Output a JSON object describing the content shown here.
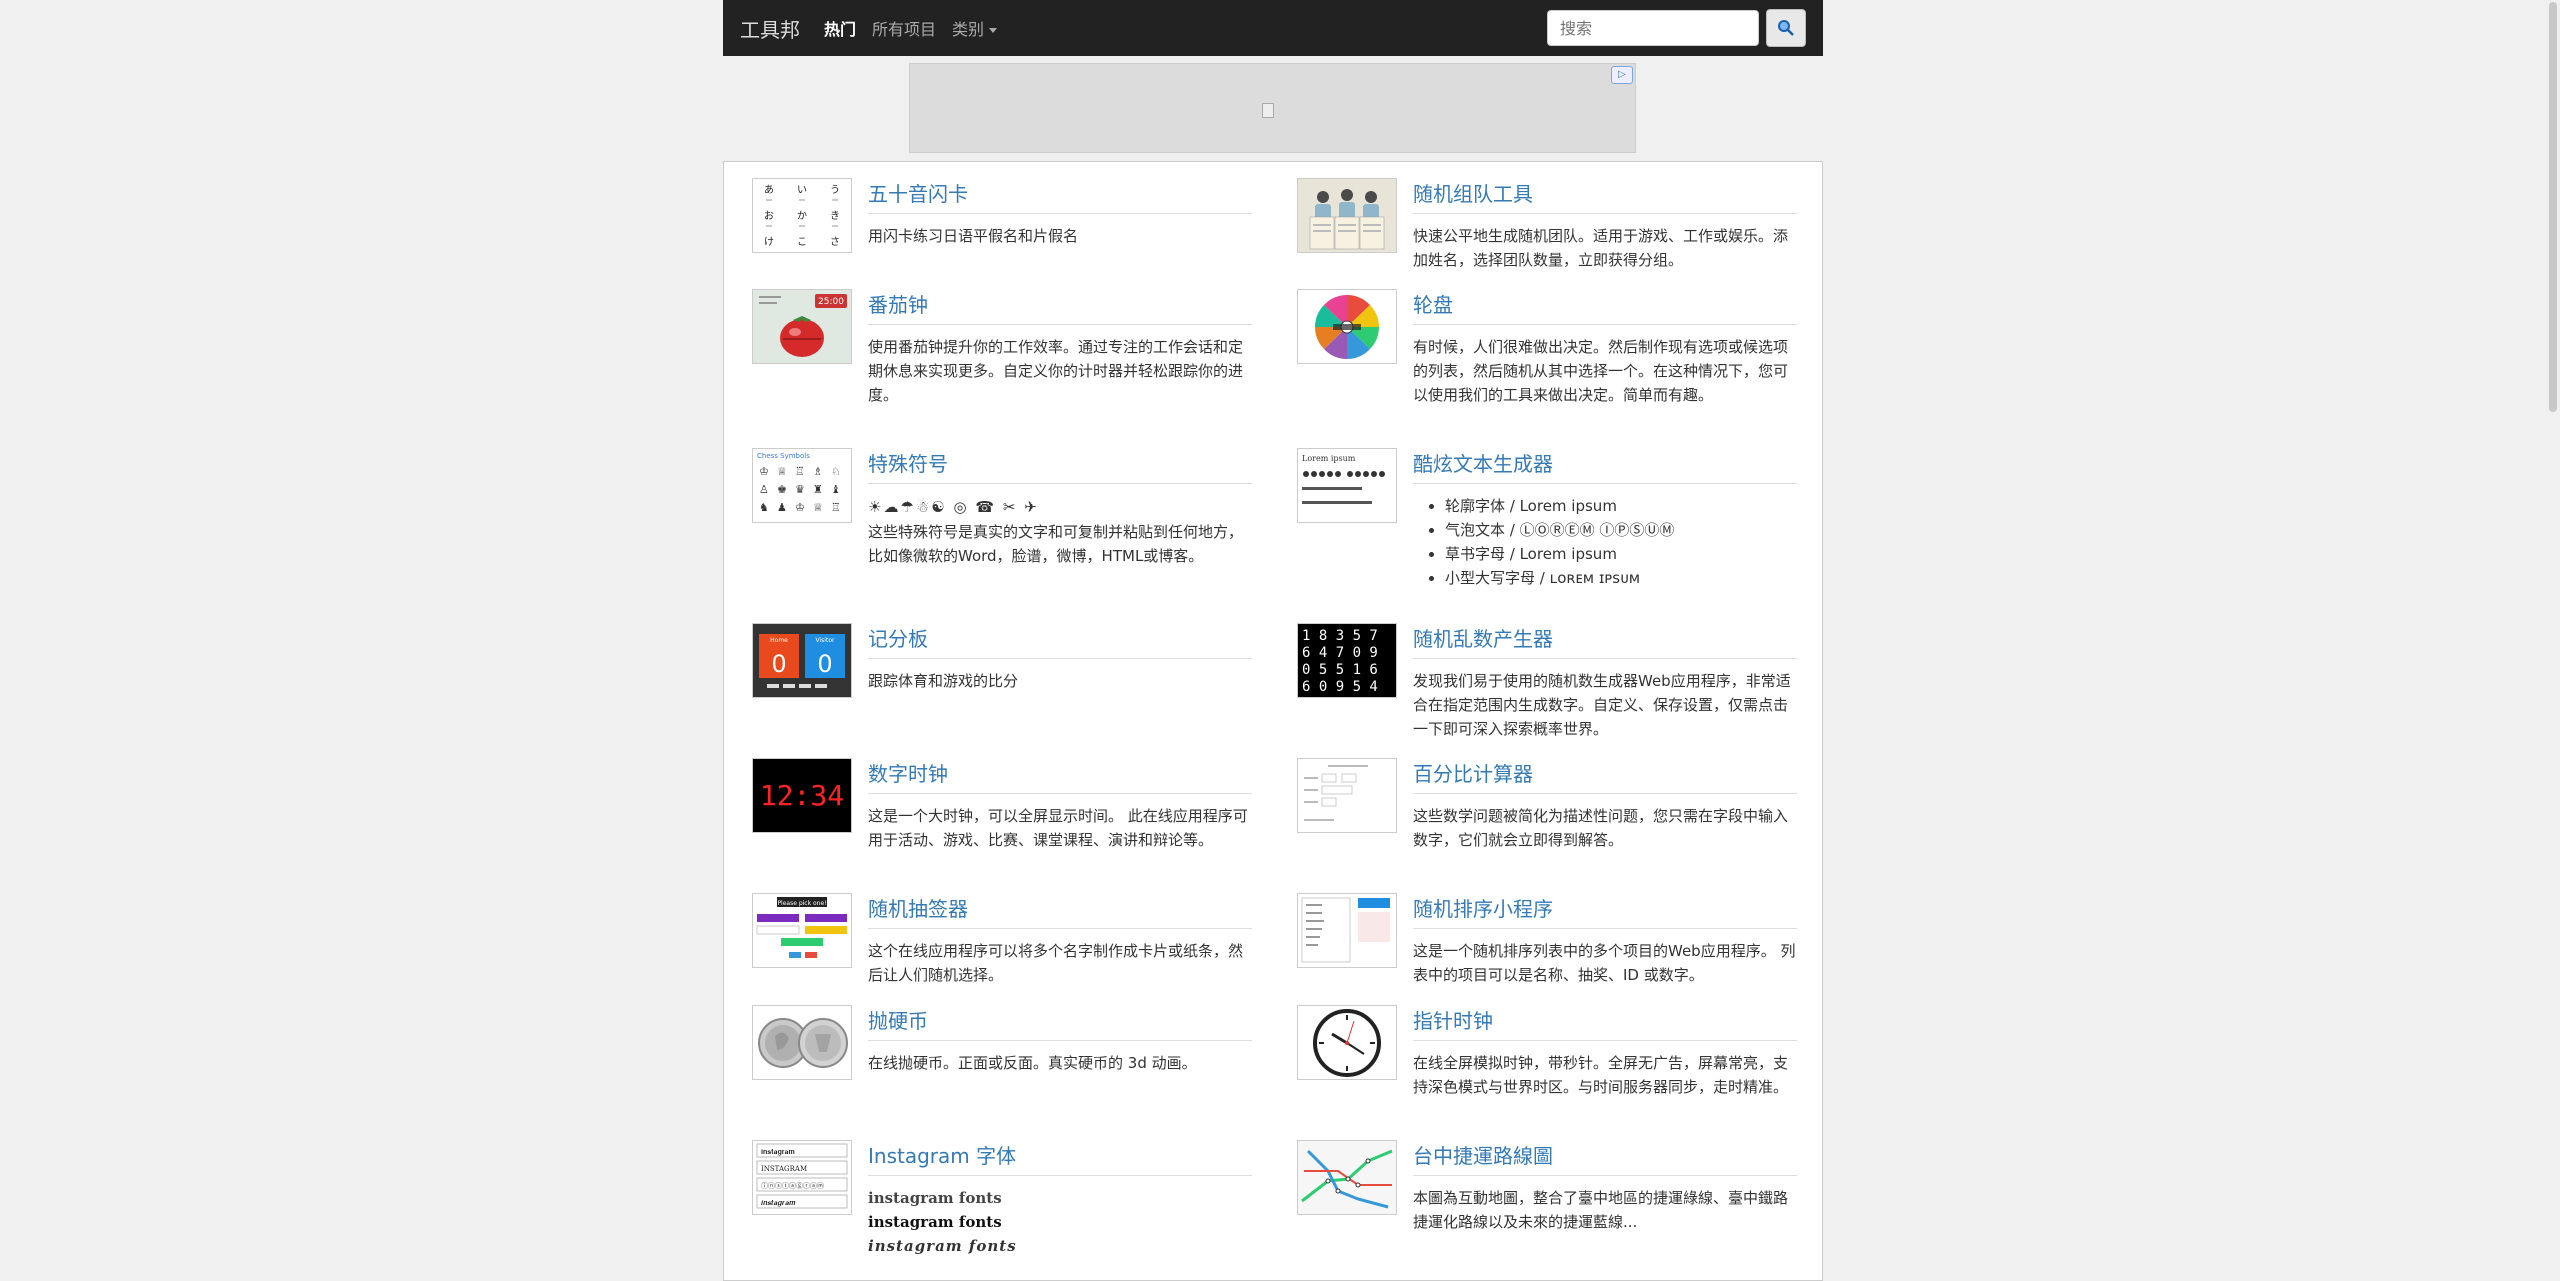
{
  "nav": {
    "brand": "工具邦",
    "items": [
      "热门",
      "所有项目",
      "类别"
    ],
    "search_placeholder": "搜索"
  },
  "ad": {
    "badge": "▷"
  },
  "cards": [
    {
      "title": "五十音闪卡",
      "desc": "用闪卡练习日语平假名和片假名",
      "thumb_glyphs": [
        "あ",
        "い",
        "う",
        "お",
        "か",
        "き",
        "け",
        "こ",
        "さ"
      ]
    },
    {
      "title": "随机组队工具",
      "desc": "快速公平地生成随机团队。适用于游戏、工作或娱乐。添加姓名，选择团队数量，立即获得分组。"
    },
    {
      "title": "番茄钟",
      "desc": "使用番茄钟提升你的工作效率。通过专注的工作会话和定期休息来实现更多。自定义你的计时器并轻松跟踪你的进度。",
      "thumb_time": "25:00"
    },
    {
      "title": "轮盘",
      "desc": "有时候，人们很难做出决定。然后制作现有选项或候选项的列表，然后随机从其中选择一个。在这种情况下，您可以使用我们的工具来做出决定。简单而有趣。"
    },
    {
      "title": "特殊符号",
      "symbols": "☀☁☂☃☯ ◎ ☎ ✂ ✈",
      "desc": "这些特殊符号是真实的文字和可复制并粘贴到任何地方，比如像微软的Word，脸谱，微博，HTML或博客。",
      "thumb_label": "Chess Symbols"
    },
    {
      "title": "酷炫文本生成器",
      "list": [
        "轮廓字体 / Lorem ipsum",
        "气泡文本 / ⓁⓄⓇⒺⓂ ⒾⓅⓈⓊⓂ",
        "草书字母 / Lorem ipsum",
        "小型大写字母 / ʟᴏʀᴇᴍ ɪᴘsᴜᴍ"
      ],
      "thumb_label": "Lorem ipsum"
    },
    {
      "title": "记分板",
      "desc": "跟踪体育和游戏的比分",
      "thumb_home": "Home",
      "thumb_visitor": "Visitor",
      "thumb_score": "0"
    },
    {
      "title": "随机乱数产生器",
      "desc": "发现我们易于使用的随机数生成器Web应用程序，非常适合在指定范围内生成数字。自定义、保存设置，仅需点击一下即可深入探索概率世界。",
      "thumb_rows": [
        "1 8 3 5 7",
        "6 4 7 0 9",
        "0 5 5 1 6",
        "6 0 9 5 4"
      ]
    },
    {
      "title": "数字时钟",
      "desc": "这是一个大时钟，可以全屏显示时间。 此在线应用程序可用于活动、游戏、比赛、课堂课程、演讲和辩论等。",
      "thumb_time": "12:34"
    },
    {
      "title": "百分比计算器",
      "desc": "这些数学问题被简化为描述性问题，您只需在字段中输入数字，它们就会立即得到解答。"
    },
    {
      "title": "随机抽签器",
      "desc": "这个在线应用程序可以将多个名字制作成卡片或纸条，然后让人们随机选择。",
      "thumb_label": "Please pick one!"
    },
    {
      "title": "随机排序小程序",
      "desc": "这是一个随机排序列表中的多个项目的Web应用程序。 列表中的项目可以是名称、抽奖、ID 或数字。"
    },
    {
      "title": "抛硬币",
      "desc": "在线抛硬币。正面或反面。真实硬币的 3d 动画。"
    },
    {
      "title": "指针时钟",
      "desc": "在线全屏模拟时钟，带秒针。全屏无广告，屏幕常亮，支持深色模式与世界时区。与时间服务器同步，走时精准。"
    },
    {
      "title": "Instagram 字体",
      "lines": [
        "instagram fonts",
        "instagram fonts",
        "instagram fonts"
      ],
      "thumb_lines": [
        "𝐢𝐧𝐬𝐭𝐚𝐠𝐫𝐚𝐦",
        "INSTAGRAM",
        "ⓘⓝⓢⓣⓐⓖⓡⓐⓜ",
        "𝒊𝒏𝒔𝒕𝒂𝒈𝒓𝒂𝒎"
      ]
    },
    {
      "title": "台中捷運路線圖",
      "desc": "本圖為互動地圖，整合了臺中地區的捷運綠線、臺中鐵路捷運化路線以及未來的捷運藍線..."
    }
  ]
}
